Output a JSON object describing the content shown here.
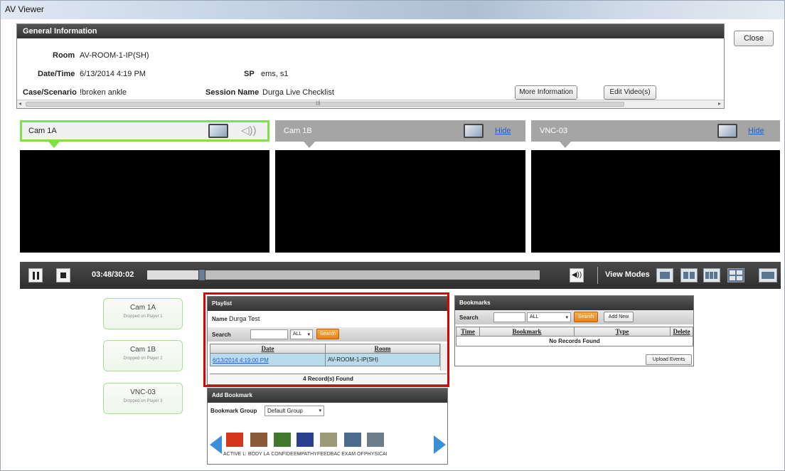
{
  "window": {
    "title": "AV Viewer"
  },
  "general_info": {
    "header": "General Information",
    "room_label": "Room",
    "room_value": "AV-ROOM-1-IP(SH)",
    "datetime_label": "Date/Time",
    "datetime_value": "6/13/2014 4:19 PM",
    "sp_label": "SP",
    "sp_value": "ems, s1",
    "case_label": "Case/Scenario",
    "case_value": "!broken ankle",
    "session_label": "Session Name",
    "session_value": "Durga Live Checklist",
    "more_info_label": "More Information",
    "edit_video_label": "Edit Video(s)",
    "scroll_grip": "III",
    "scroll_left": "◂",
    "scroll_right": "▸"
  },
  "close_label": "Close",
  "cameras": [
    {
      "name": "Cam 1A",
      "active": true
    },
    {
      "name": "Cam 1B",
      "hide_label": "Hide"
    },
    {
      "name": "VNC-03",
      "hide_label": "Hide"
    }
  ],
  "speaker_glyph": "◁))",
  "player": {
    "time": "03:48/30:02",
    "progress": 0.135,
    "volume_glyph": "◀))",
    "view_modes_label": "View Modes"
  },
  "drop_items": [
    {
      "name": "Cam 1A",
      "status": "Dropped on Player  1"
    },
    {
      "name": "Cam 1B",
      "status": "Dropped on Player  2"
    },
    {
      "name": "VNC-03",
      "status": "Dropped on Player  3"
    }
  ],
  "playlist": {
    "header": "Playlist",
    "name_label": "Name",
    "name_value": "Durga Test",
    "search_label": "Search",
    "filter_value": "ALL",
    "search_button": "Search",
    "columns": [
      "Date",
      "Room"
    ],
    "rows": [
      {
        "date": "6/13/2014 4:19:00 PM",
        "room": "AV-ROOM-1-IP(SH)"
      }
    ],
    "records_found": "4 Record(s) Found"
  },
  "add_bookmark": {
    "header": "Add Bookmark",
    "group_label": "Bookmark Group",
    "group_value": "Default Group",
    "items": [
      {
        "caption": "ACTIVE LI",
        "color": "#d6361b"
      },
      {
        "caption": "BODY LA",
        "color": "#8a5a3a"
      },
      {
        "caption": "CONFIDE",
        "color": "#3f7a2a"
      },
      {
        "caption": "EMPATHY",
        "color": "#2b3f8f"
      },
      {
        "caption": "FEEDBAC",
        "color": "#9b9b7a"
      },
      {
        "caption": "EXAM OF",
        "color": "#4d6b8f"
      },
      {
        "caption": "PHYSICAI",
        "color": "#6d7d8a"
      }
    ]
  },
  "bookmarks": {
    "header": "Bookmarks",
    "search_label": "Search",
    "filter_value": "ALL",
    "search_button": "Search",
    "add_new_button": "Add New",
    "columns": [
      "Time",
      "Bookmark",
      "Type",
      "Delete"
    ],
    "empty_text": "No Records Found",
    "upload_button": "Upload Events"
  },
  "colors": {
    "active_cam": "#7fe04a",
    "highlight": "#e00000",
    "accent_orange": "#ef8f24",
    "link": "#1a5fd6"
  }
}
